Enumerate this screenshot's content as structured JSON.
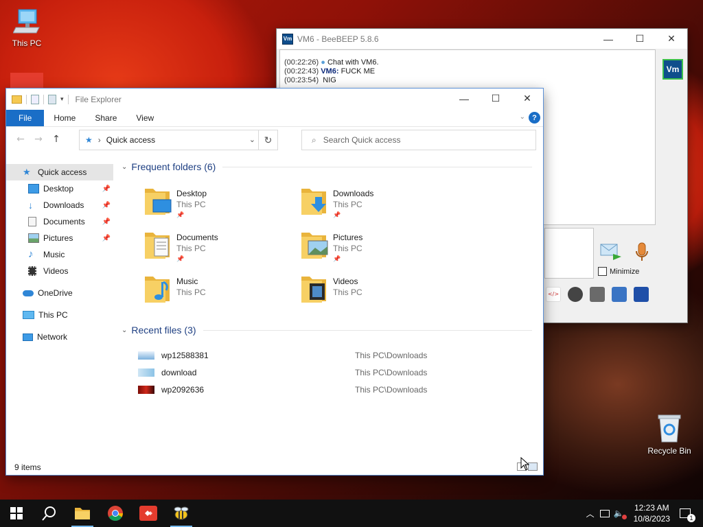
{
  "desktop": {
    "icons": [
      {
        "label": "This PC"
      },
      {
        "label": "Recycle Bin"
      }
    ]
  },
  "beebeep": {
    "title": "VM6 - BeeBEEP 5.8.6",
    "app_badge": "Vm",
    "chat": [
      {
        "time": "(00:22:26)",
        "sender": "",
        "text": "Chat with VM6."
      },
      {
        "time": "(00:22:43)",
        "sender": "VM6:",
        "text": "FUCK ME"
      },
      {
        "time": "(00:23:54)",
        "sender": "",
        "text": "NIG"
      }
    ],
    "minimize_label": "Minimize"
  },
  "explorer": {
    "title": "File Explorer",
    "ribbon_tabs": [
      "File",
      "Home",
      "Share",
      "View"
    ],
    "help_label": "?",
    "address": {
      "location": "Quick access"
    },
    "search": {
      "placeholder": "Search Quick access"
    },
    "sidebar": [
      {
        "label": "Quick access",
        "icon": "star-icon",
        "selected": true,
        "pinned": false
      },
      {
        "label": "Desktop",
        "icon": "desktop-icon",
        "pinned": true
      },
      {
        "label": "Downloads",
        "icon": "download-icon",
        "pinned": true
      },
      {
        "label": "Documents",
        "icon": "document-icon",
        "pinned": true
      },
      {
        "label": "Pictures",
        "icon": "pictures-icon",
        "pinned": true
      },
      {
        "label": "Music",
        "icon": "music-icon",
        "pinned": false
      },
      {
        "label": "Videos",
        "icon": "videos-icon",
        "pinned": false
      },
      {
        "label": "OneDrive",
        "icon": "cloud-icon"
      },
      {
        "label": "This PC",
        "icon": "computer-icon"
      },
      {
        "label": "Network",
        "icon": "network-icon"
      }
    ],
    "frequent_header": "Frequent folders (6)",
    "frequent": [
      {
        "name": "Desktop",
        "sub": "This PC",
        "pinned": true,
        "icon": "desktop-folder-icon"
      },
      {
        "name": "Downloads",
        "sub": "This PC",
        "pinned": true,
        "icon": "downloads-folder-icon"
      },
      {
        "name": "Documents",
        "sub": "This PC",
        "pinned": true,
        "icon": "documents-folder-icon"
      },
      {
        "name": "Pictures",
        "sub": "This PC",
        "pinned": true,
        "icon": "pictures-folder-icon"
      },
      {
        "name": "Music",
        "sub": "This PC",
        "pinned": false,
        "icon": "music-folder-icon"
      },
      {
        "name": "Videos",
        "sub": "This PC",
        "pinned": false,
        "icon": "videos-folder-icon"
      }
    ],
    "recent_header": "Recent files (3)",
    "recent": [
      {
        "name": "wp12588381",
        "location": "This PC\\Downloads"
      },
      {
        "name": "download",
        "location": "This PC\\Downloads"
      },
      {
        "name": "wp2092636",
        "location": "This PC\\Downloads"
      }
    ],
    "status": "9 items"
  },
  "taskbar": {
    "time": "12:23 AM",
    "date": "10/8/2023",
    "notification_count": "1"
  },
  "colors": {
    "accent": "#1a6ec7",
    "folder": "#f5c952",
    "taskbar": "#111111"
  }
}
